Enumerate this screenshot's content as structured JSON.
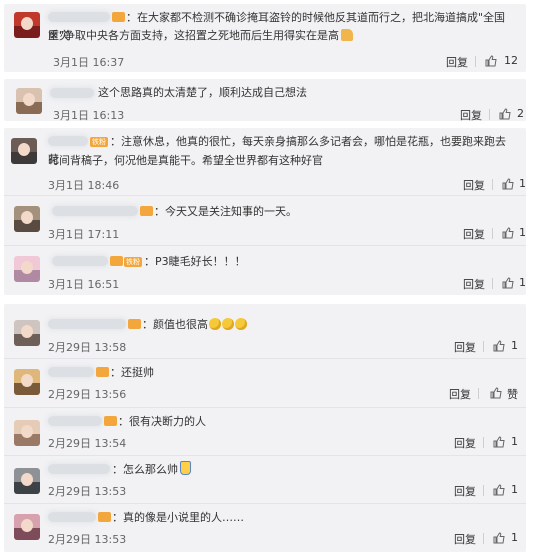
{
  "thread_a": {
    "comments": [
      {
        "text": "在大家都不检测不确诊掩耳盗铃的时候他反其道而行之，把北海道搞成\"全国重灾区\"争取中央各方面支持，这招置之死地而后生用得实在是高",
        "text_line1": "：在大家都不检测不确诊掩耳盗铃的时候他反其道而行之，把北海道搞成\"全国重灾",
        "text_line2": "区\"争取中央各方面支持，这招置之死地而后生用得实在是高",
        "time": "3月1日 16:37",
        "reply": "回复",
        "likes": "12"
      },
      {
        "text": "这个思路真的太清楚了，顺利达成自己想法",
        "time": "3月1日 16:13",
        "reply": "回复",
        "likes": "2"
      }
    ]
  },
  "thread_b": {
    "comments": [
      {
        "text_line1": "：注意休息，他真的很忙，每天亲身搞那么多记者会，哪怕是花瓶，也要跑来跑去花",
        "text_line2": "时间背稿子，何况他是真能干。希望全世界都有这种好官",
        "time": "3月1日 18:46",
        "reply": "回复",
        "likes": "1"
      },
      {
        "text": "：今天又是关注知事的一天。",
        "time": "3月1日 17:11",
        "reply": "回复",
        "likes": "1"
      },
      {
        "badge": "铁粉",
        "text": "P3睫毛好长！！！",
        "time": "3月1日 16:51",
        "reply": "回复",
        "likes": "1"
      }
    ]
  },
  "thread_c": {
    "comments": [
      {
        "text": "：颜值也很高",
        "time": "2月29日 13:58",
        "reply": "回复",
        "likes": "1"
      },
      {
        "text": "：还挺帅",
        "time": "2月29日 13:56",
        "reply": "回复",
        "likes": "赞"
      },
      {
        "text": "：很有决断力的人",
        "time": "2月29日 13:54",
        "reply": "回复",
        "likes": "1"
      },
      {
        "text": "：怎么那么帅",
        "time": "2月29日 13:53",
        "reply": "回复",
        "likes": "1"
      },
      {
        "text": "：真的像是小说里的人……",
        "time": "2月29日 13:53",
        "reply": "回复",
        "likes": "1"
      }
    ]
  },
  "colors": {
    "card_bg": "#f2f2f5",
    "badge_orange": "#f2a63b",
    "text": "#333333",
    "meta": "#666666"
  }
}
